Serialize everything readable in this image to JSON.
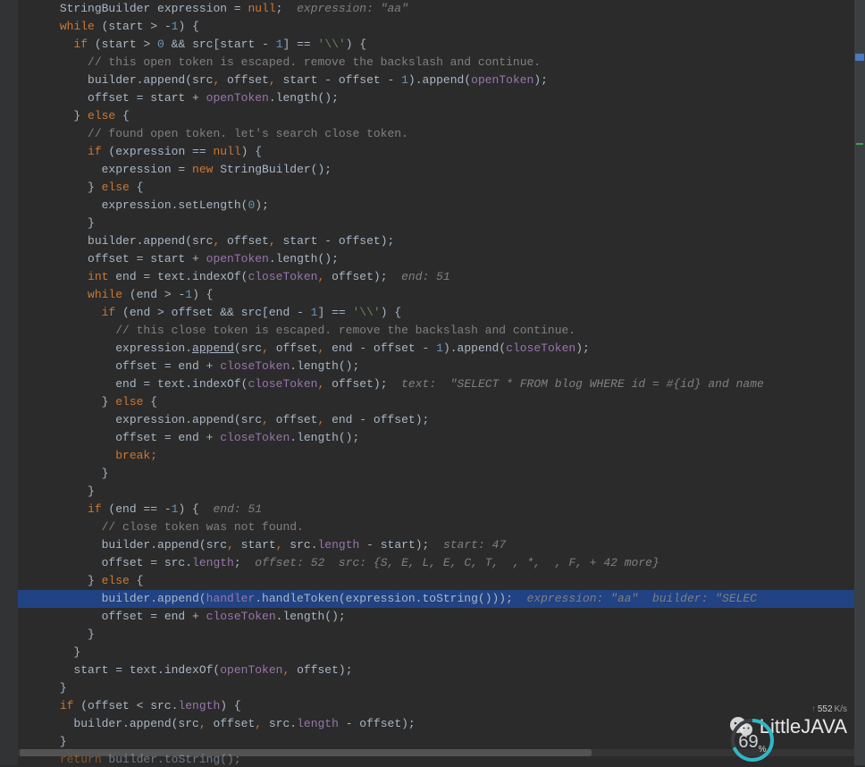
{
  "code": {
    "lines": [
      "      StringBuilder expression = null;  expression: \"aa\"",
      "      while (start > -1) {",
      "        if (start > 0 && src[start - 1] == '\\\\') {",
      "          // this open token is escaped. remove the backslash and continue.",
      "          builder.append(src, offset, start - offset - 1).append(openToken);",
      "          offset = start + openToken.length();",
      "        } else {",
      "          // found open token. let's search close token.",
      "          if (expression == null) {",
      "            expression = new StringBuilder();",
      "          } else {",
      "            expression.setLength(0);",
      "          }",
      "          builder.append(src, offset, start - offset);",
      "          offset = start + openToken.length();",
      "          int end = text.indexOf(closeToken, offset);  end: 51",
      "          while (end > -1) {",
      "            if (end > offset && src[end - 1] == '\\\\') {",
      "              // this close token is escaped. remove the backslash and continue.",
      "              expression.append(src, offset, end - offset - 1).append(closeToken);",
      "              offset = end + closeToken.length();",
      "              end = text.indexOf(closeToken, offset);  text:  \"SELECT * FROM blog WHERE id = #{id} and name ",
      "            } else {",
      "              expression.append(src, offset, end - offset);",
      "              offset = end + closeToken.length();",
      "              break;",
      "            }",
      "          }",
      "          if (end == -1) {  end: 51",
      "            // close token was not found.",
      "            builder.append(src, start, src.length - start);  start: 47",
      "            offset = src.length;  offset: 52  src: {S, E, L, E, C, T,  , *,  , F, + 42 more}",
      "          } else {",
      "            builder.append(handler.handleToken(expression.toString()));  expression: \"aa\"  builder: \"SELEC",
      "            offset = end + closeToken.length();",
      "          }",
      "        }",
      "        start = text.indexOf(openToken, offset);",
      "      }",
      "      if (offset < src.length) {",
      "        builder.append(src, offset, src.length - offset);",
      "      }",
      "      return builder.toString();"
    ],
    "highlighted_line_index": 33
  },
  "debug_hints": {
    "line0": "expression: \"aa\"",
    "line15_end": "end: 51",
    "line21_text": "text:  \"SELECT * FROM blog WHERE id = #{id} and name ",
    "line28_end": "end: 51",
    "line30_start": "start: 47",
    "line31_offset_src": "offset: 52  src: {S, E, L, E, C, T,  , *,  , F, + 42 more}",
    "line33_expr_builder": "expression: \"aa\"  builder: \"SELEC"
  },
  "watermark": {
    "text": "LittleJAVA"
  },
  "network": {
    "upload": "552",
    "unit": "K/s"
  },
  "gauge": {
    "value": "69",
    "unit": "%"
  }
}
